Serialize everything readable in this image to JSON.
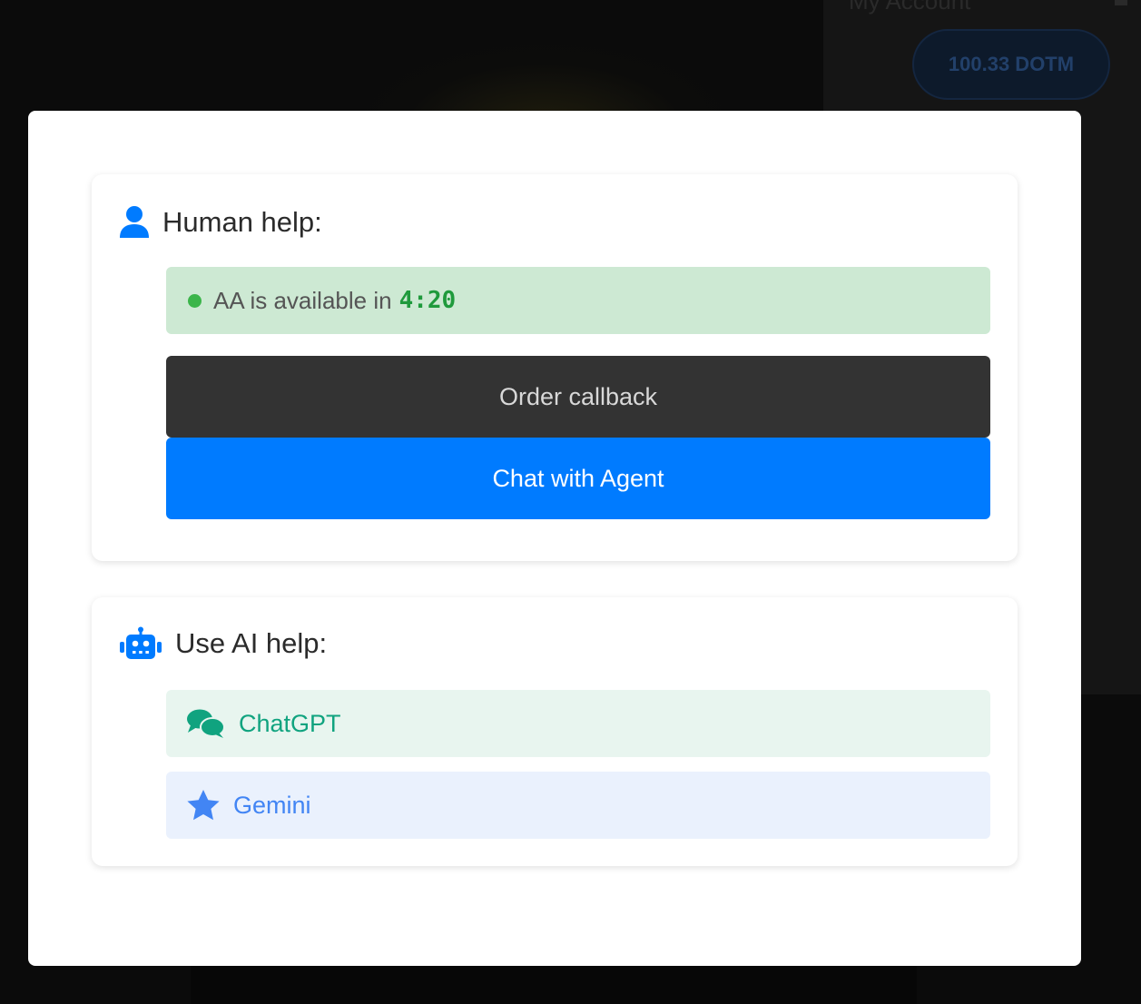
{
  "background": {
    "account_title": "My Account",
    "balance": "100.33 DOTM"
  },
  "human_help": {
    "title": "Human help:",
    "icon": "user-icon",
    "status_text": "AA is available in",
    "timer": "4:20",
    "status_color": "#3bb54a",
    "callback_label": "Order callback",
    "agent_label": "Chat with Agent"
  },
  "ai_help": {
    "title": "Use AI help:",
    "icon": "robot-icon",
    "options": [
      {
        "label": "ChatGPT",
        "icon": "comments-icon",
        "color": "#10a37f",
        "bg": "#e8f5ef"
      },
      {
        "label": "Gemini",
        "icon": "star-icon",
        "color": "#4285f4",
        "bg": "#eaf1fd"
      }
    ]
  },
  "colors": {
    "primary": "#007bff",
    "dark_button": "#333333",
    "status_bg": "#cde9d3"
  }
}
